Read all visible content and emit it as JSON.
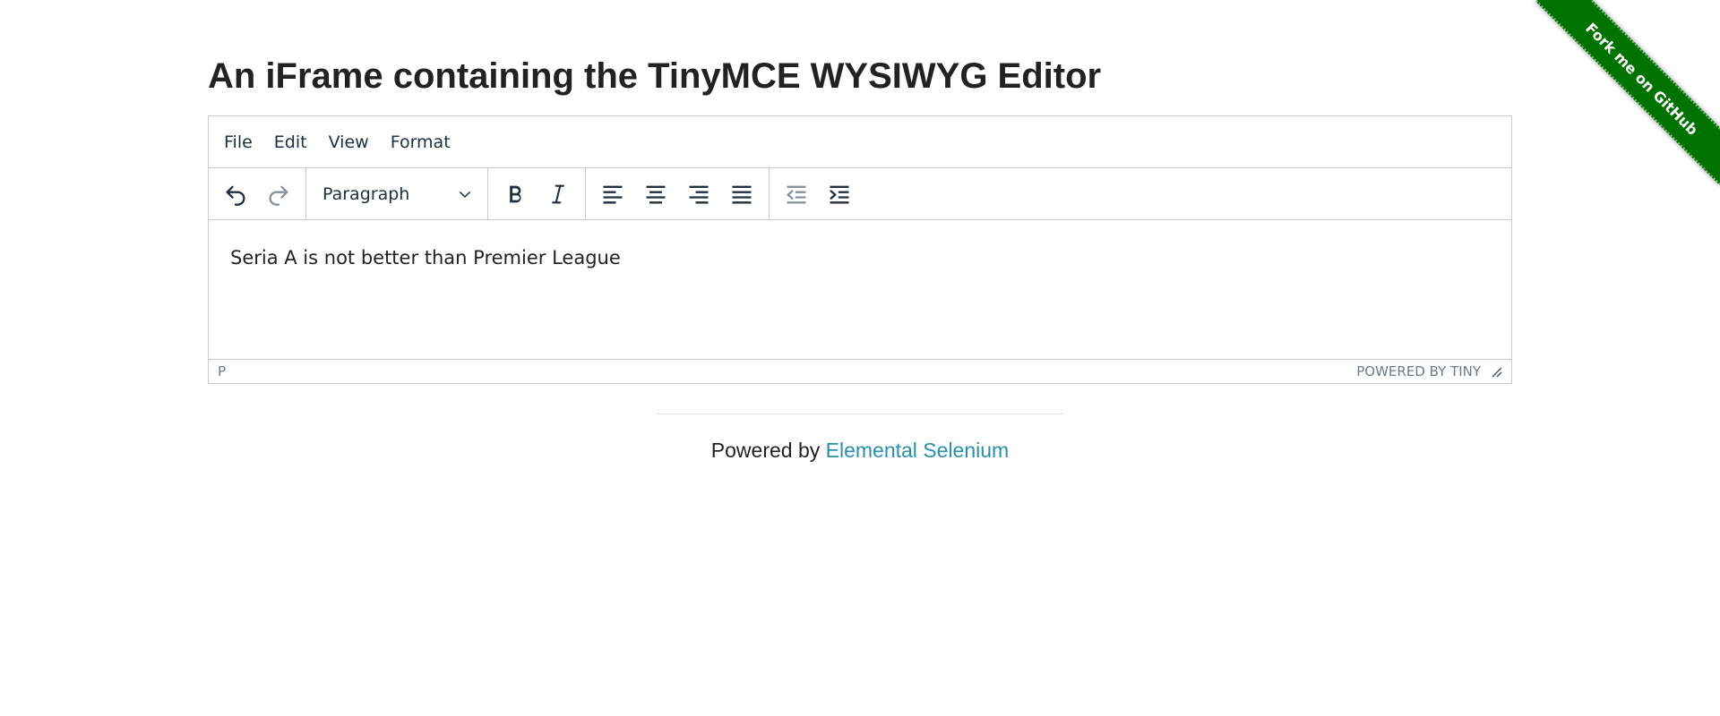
{
  "page": {
    "title": "An iFrame containing the TinyMCE WYSIWYG Editor"
  },
  "ribbon": {
    "label": "Fork me on GitHub",
    "color": "#007200"
  },
  "editor": {
    "menubar": {
      "items": [
        {
          "label": "File"
        },
        {
          "label": "Edit"
        },
        {
          "label": "View"
        },
        {
          "label": "Format"
        }
      ]
    },
    "toolbar": {
      "undo_icon": "undo-icon",
      "redo_icon": "redo-icon",
      "block_format": "Paragraph",
      "bold_icon": "bold-icon",
      "italic_icon": "italic-icon",
      "align_icons": [
        "align-left-icon",
        "align-center-icon",
        "align-right-icon",
        "align-justify-icon"
      ],
      "outdent_icon": "outdent-icon",
      "indent_icon": "indent-icon"
    },
    "body_text": "Seria A is not better than Premier League",
    "statusbar": {
      "path": "P",
      "branding": "POWERED BY TINY"
    }
  },
  "footer": {
    "prefix": "Powered by ",
    "link_text": "Elemental Selenium",
    "link_color": "#2a8fa8"
  }
}
